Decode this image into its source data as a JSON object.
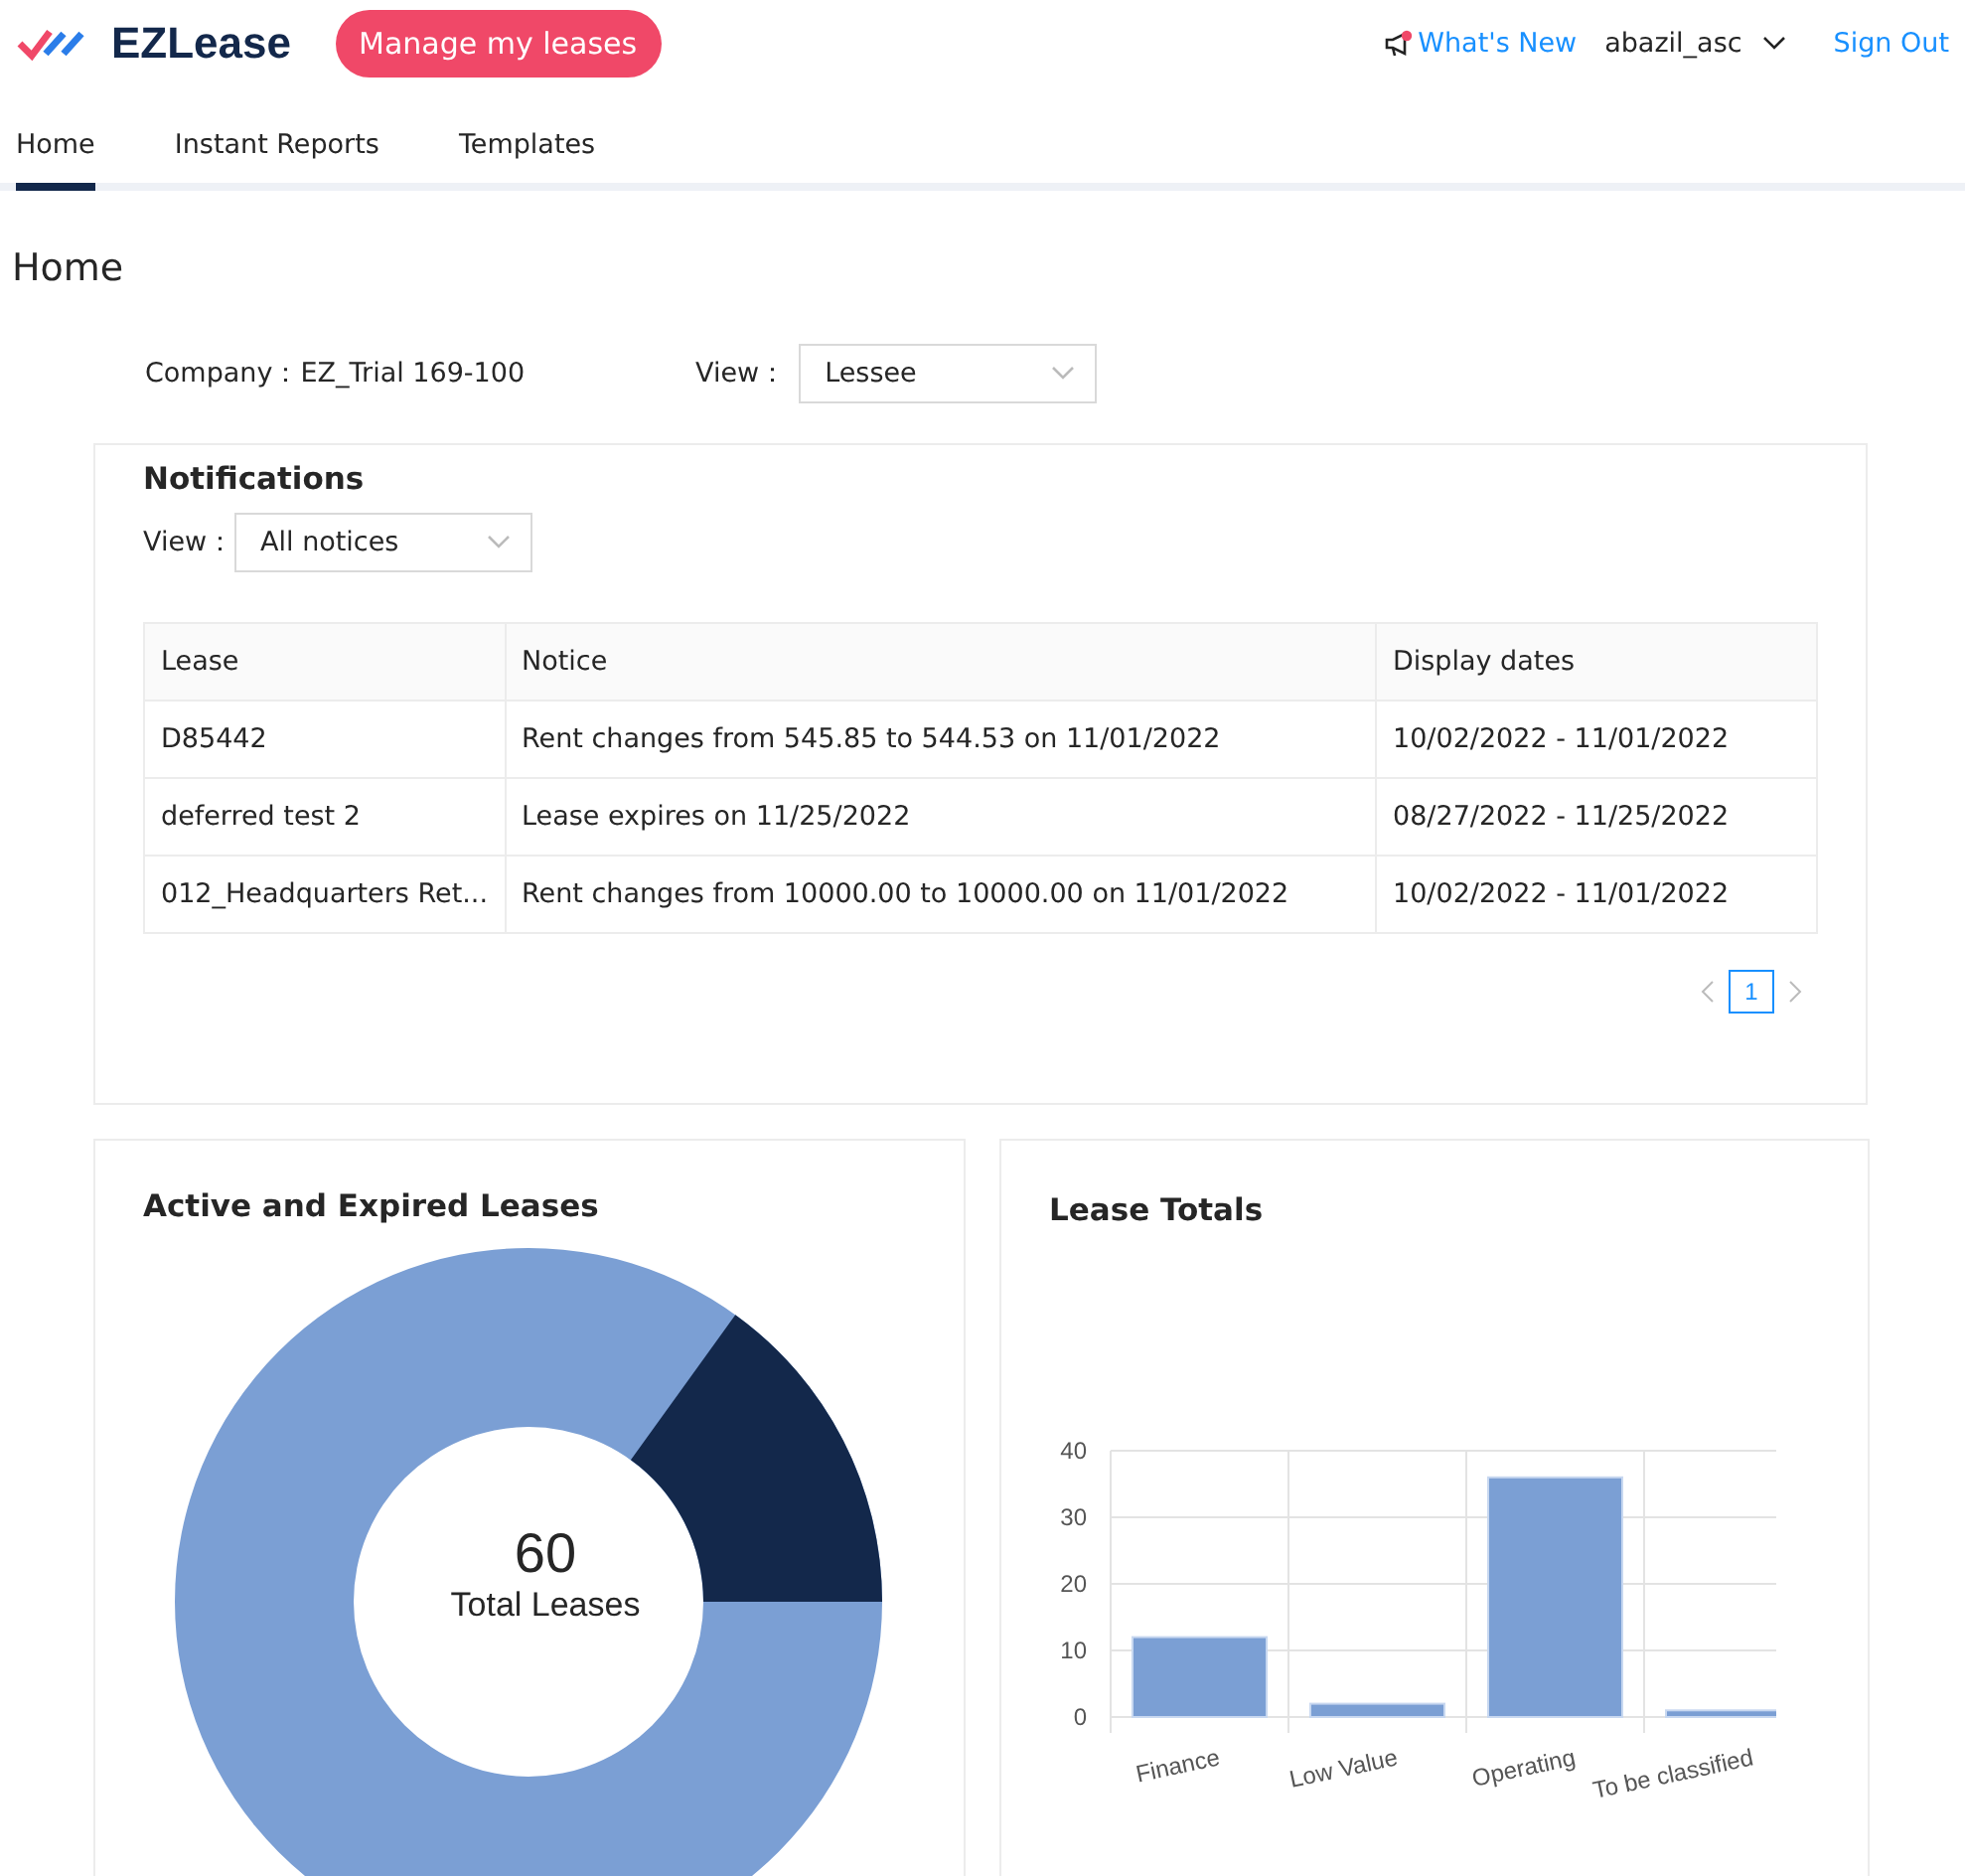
{
  "header": {
    "logo": "EZLease",
    "manage_button": "Manage my leases",
    "whats_new": "What's New",
    "whats_new_unread": true,
    "user": "abazil_asc",
    "sign_out": "Sign Out"
  },
  "tabs": [
    {
      "label": "Home",
      "selected": true
    },
    {
      "label": "Instant Reports",
      "selected": false
    },
    {
      "label": "Templates",
      "selected": false
    }
  ],
  "page_title": "Home",
  "filters": {
    "company_label": "Company：",
    "company": "EZ_Trial 169-100",
    "view_label": "View：",
    "view": "Lessee"
  },
  "notifications": {
    "title": "Notifications",
    "view_label": "View：",
    "view": "All notices",
    "table": {
      "columns": [
        "Lease",
        "Notice",
        "Display dates"
      ],
      "rows": [
        [
          "D85442",
          "Rent changes from 545.85 to 544.53 on 11/01/2022",
          "10/02/2022 - 11/01/2022"
        ],
        [
          "deferred test 2",
          "Lease expires on 11/25/2022",
          "08/27/2022 - 11/25/2022"
        ],
        [
          "012_Headquarters Ret...",
          "Rent changes from 10000.00 to 10000.00 on 11/01/2022",
          "10/02/2022 - 11/01/2022"
        ]
      ]
    },
    "pages": [
      {
        "label": "1",
        "selected": true
      }
    ]
  },
  "active_expired": {
    "title": "Active and Expired Leases",
    "total": "60",
    "total_label": "Total Leases"
  },
  "lease_totals": {
    "title": "Lease Totals",
    "chart_data": {
      "type": "bar",
      "categories": [
        "Finance",
        "Low Value",
        "Operating",
        "To be classified"
      ],
      "series": [
        {
          "color": "#7b9fd4",
          "values": [
            12,
            2,
            36,
            1
          ]
        }
      ],
      "grid": true,
      "ylim": [
        0,
        40
      ],
      "yticks": [
        0,
        10,
        20,
        30,
        40
      ]
    }
  }
}
